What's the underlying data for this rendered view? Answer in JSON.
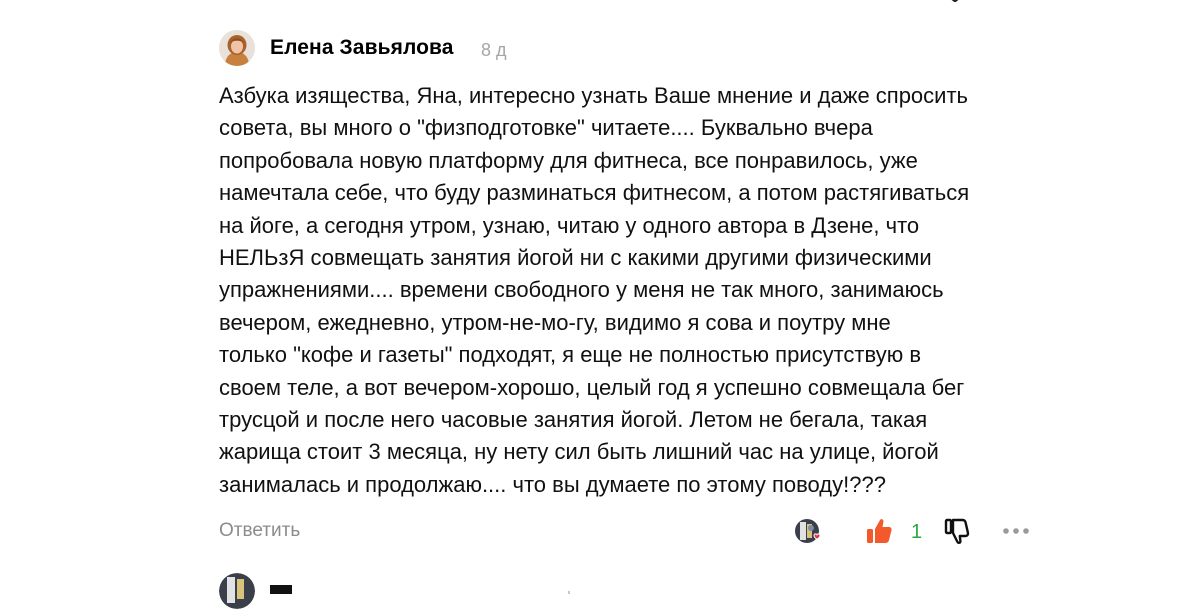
{
  "comment": {
    "author": {
      "name": "Елена Завьялова",
      "avatar_icon": "user-photo-avatar"
    },
    "time": "8 д",
    "text_lines": [
      "Азбука изящества, Яна, интересно узнать Ваше мнение и даже спросить",
      "совета, вы много о \"физподготовке\" читаете.... Буквально вчера",
      "попробовала новую платформу для фитнеса, все понравилось, уже",
      "намечтала себе, что буду разминаться фитнесом, а потом растягиваться",
      "на йоге, а сегодня утром, узнаю, читаю у одного автора в Дзене, что",
      "НЕЛЬзЯ совмещать занятия йогой ни с какими другими физическими",
      "упражнениями.... времени свободного у меня не так много, занимаюсь",
      "вечером, ежедневно, утром-не-мо-гу, видимо я сова и поутру мне",
      "только \"кофе и газеты\" подходят, я еще не полностью присутствую в",
      "своем теле, а вот вечером-хорошо, целый год я успешно совмещала бег",
      "трусцой и после него часовые занятия йогой. Летом не бегала, такая",
      "жарища стоит 3 месяца, ну нету сил быть лишний час на улице, йогой",
      "занималась и продолжаю.... что вы думаете по этому поводу!???"
    ],
    "actions": {
      "reply_label": "Ответить",
      "like_count": "1",
      "like_icon": "thumbs-up-icon",
      "dislike_icon": "thumbs-down-icon",
      "more_icon": "more-dots-icon",
      "reactor_icon": "reactor-avatar-with-heart"
    }
  },
  "colors": {
    "like_active": "#f4592b",
    "like_count": "#2ea83a",
    "muted_text": "#8c8c8c",
    "heart": "#e0334a"
  }
}
